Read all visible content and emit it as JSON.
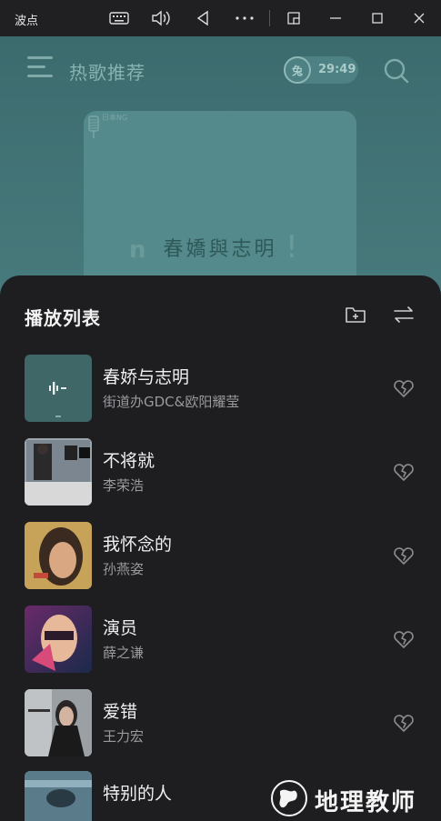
{
  "window": {
    "title": "波点",
    "icons": [
      "keyboard-icon",
      "volume-icon",
      "back-icon",
      "more-icon",
      "pip-icon",
      "minimize-icon",
      "maximize-icon",
      "close-icon"
    ]
  },
  "header": {
    "title": "热歌推荐",
    "free_badge_icon": "兔",
    "free_time": "29:49"
  },
  "now_playing": {
    "cover_text": "春嬌與志明",
    "cover_tag": "日本NG"
  },
  "playlist": {
    "title": "播放列表",
    "songs": [
      {
        "name": "春娇与志明",
        "artist": "街道办GDC&欧阳耀莹"
      },
      {
        "name": "不将就",
        "artist": "李荣浩"
      },
      {
        "name": "我怀念的",
        "artist": "孙燕姿"
      },
      {
        "name": "演员",
        "artist": "薛之谦"
      },
      {
        "name": "爱错",
        "artist": "王力宏"
      },
      {
        "name": "特别的人",
        "artist": ""
      }
    ]
  },
  "watermark": {
    "text": "地理教师"
  },
  "colors": {
    "player_bg": "#487b7d",
    "panel_bg": "#1e1e21",
    "accent": "#a8cac8"
  }
}
